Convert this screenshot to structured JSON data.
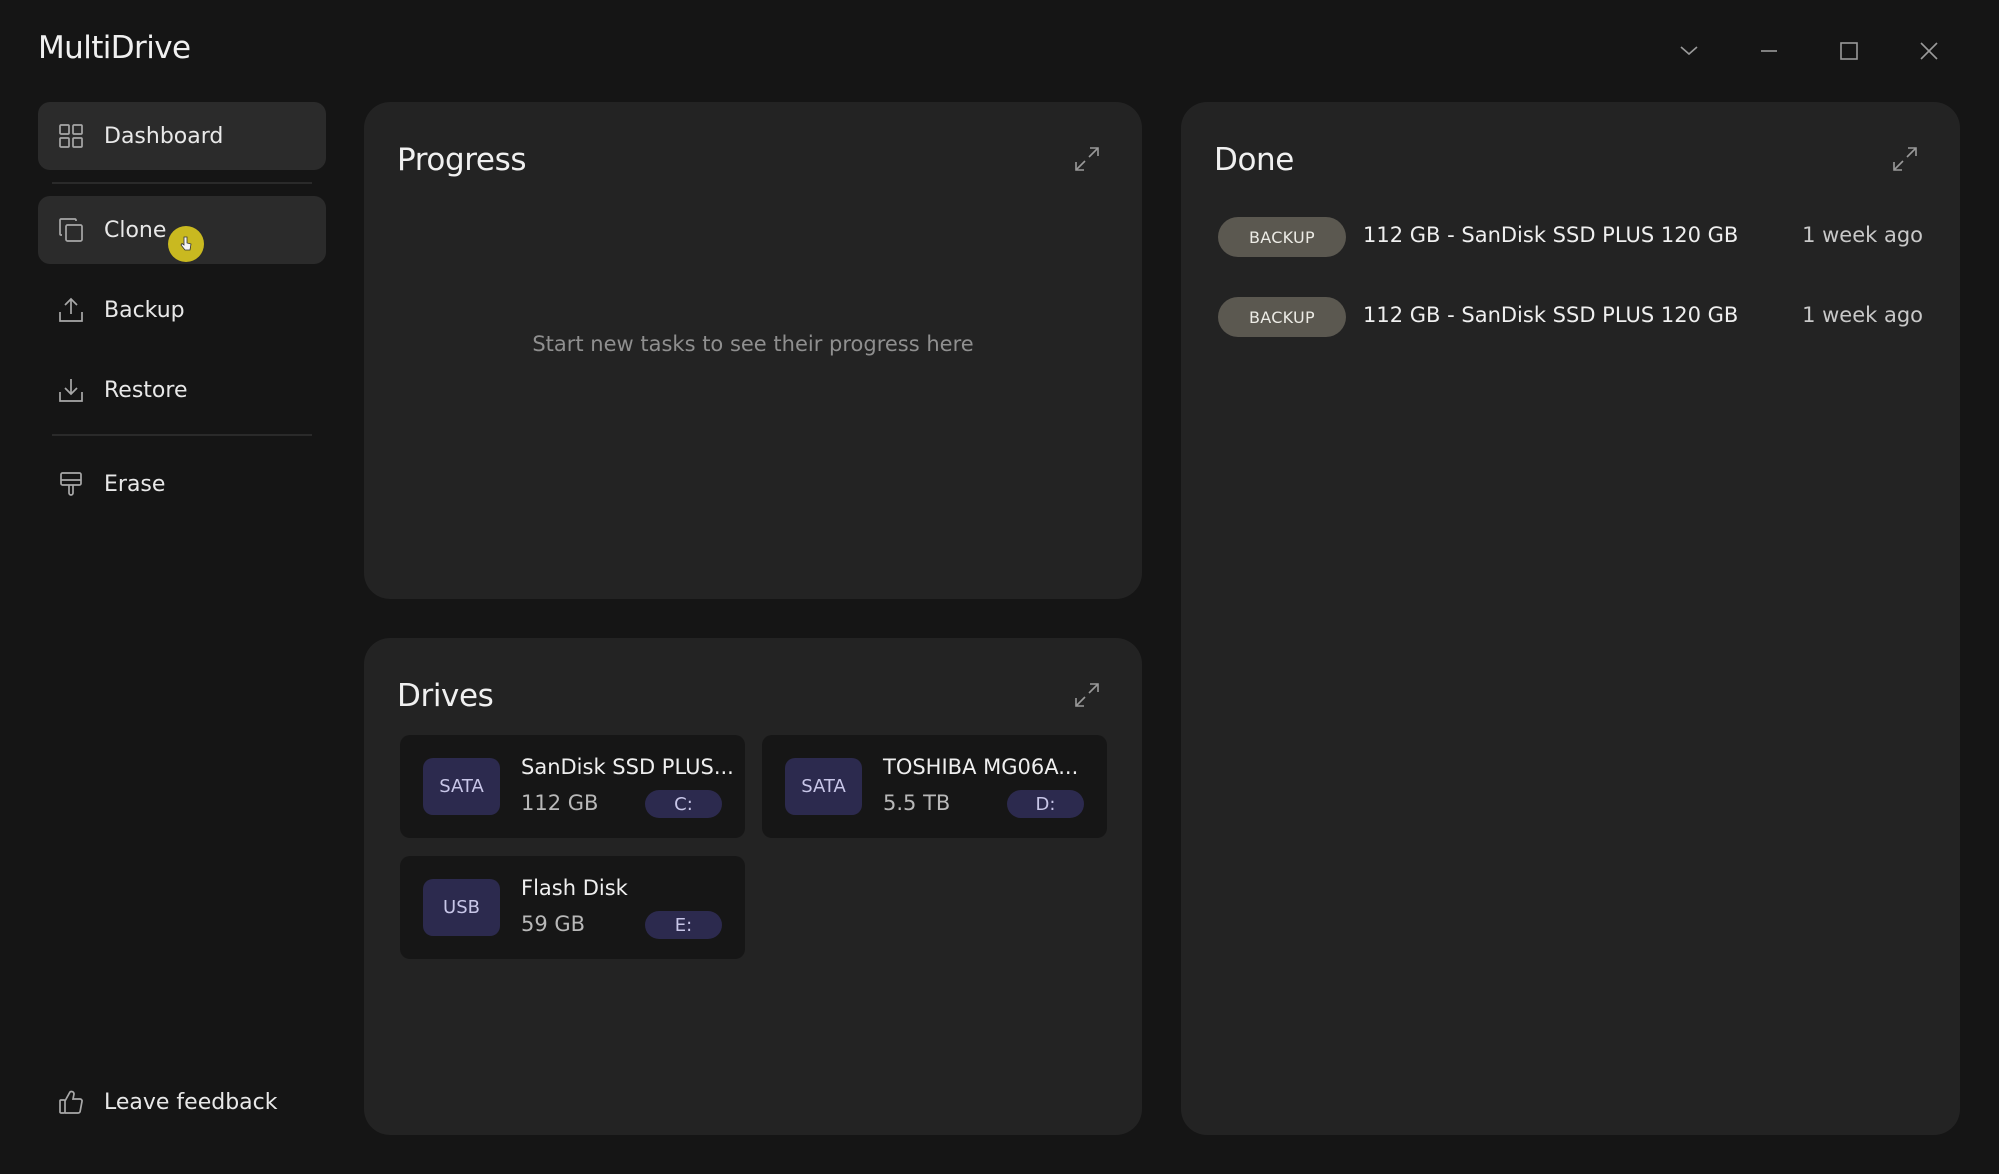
{
  "app": {
    "title": "MultiDrive"
  },
  "window_controls": {
    "icons": [
      "chevron-down-icon",
      "minimize-icon",
      "maximize-icon",
      "close-icon"
    ]
  },
  "sidebar": {
    "items": [
      {
        "label": "Dashboard",
        "icon": "grid-icon",
        "active": true
      },
      {
        "label": "Clone",
        "icon": "clone-icon",
        "active": true
      },
      {
        "label": "Backup",
        "icon": "upload-icon",
        "active": false
      },
      {
        "label": "Restore",
        "icon": "download-icon",
        "active": false
      },
      {
        "label": "Erase",
        "icon": "brush-icon",
        "active": false
      }
    ],
    "feedback": {
      "label": "Leave feedback",
      "icon": "thumbs-up-icon"
    }
  },
  "progress": {
    "title": "Progress",
    "empty_message": "Start new tasks to see their progress here"
  },
  "drives": {
    "title": "Drives",
    "items": [
      {
        "type": "SATA",
        "name": "SanDisk SSD PLUS...",
        "size": "112 GB",
        "letter": "C:"
      },
      {
        "type": "SATA",
        "name": "TOSHIBA MG06A...",
        "size": "5.5 TB",
        "letter": "D:"
      },
      {
        "type": "USB",
        "name": "Flash Disk",
        "size": "59 GB",
        "letter": "E:"
      }
    ]
  },
  "done": {
    "title": "Done",
    "items": [
      {
        "badge": "BACKUP",
        "text": "112 GB - SanDisk SSD PLUS 120 GB",
        "time": "1 week ago"
      },
      {
        "badge": "BACKUP",
        "text": "112 GB - SanDisk SSD PLUS 120 GB",
        "time": "1 week ago"
      }
    ]
  },
  "colors": {
    "background": "#151515",
    "panel": "#232323",
    "accent_drive": "#2c2a4e",
    "badge": "#5b5850",
    "cursor_highlight": "#c9b920"
  }
}
